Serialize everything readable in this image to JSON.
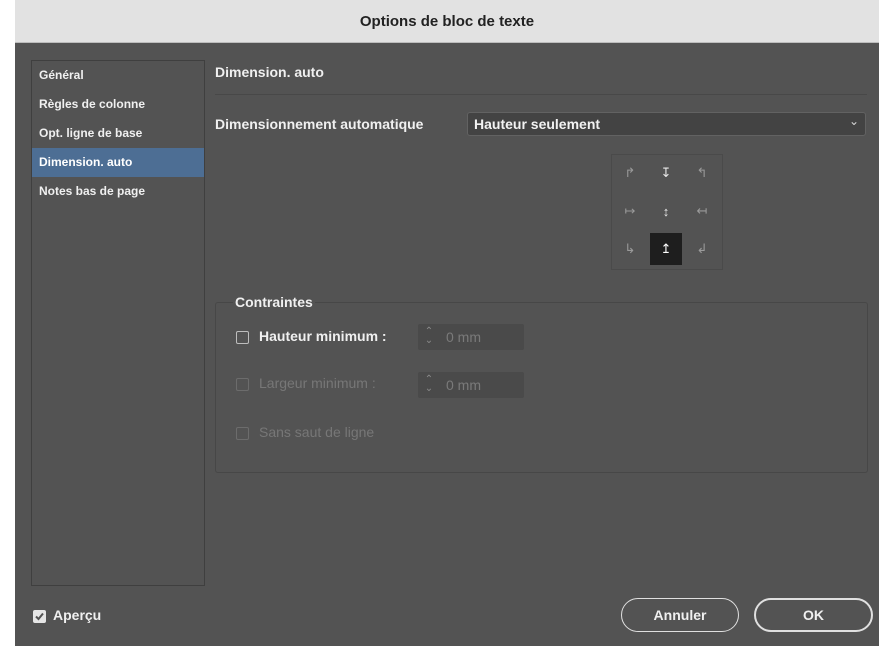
{
  "dialog": {
    "title": "Options de bloc de texte"
  },
  "sidebar": {
    "items": [
      {
        "label": "Général"
      },
      {
        "label": "Règles de colonne"
      },
      {
        "label": "Opt. ligne de base"
      },
      {
        "label": "Dimension. auto"
      },
      {
        "label": "Notes bas de page"
      }
    ],
    "active_index": 3
  },
  "main": {
    "section_title": "Dimension. auto",
    "auto_size_label": "Dimensionnement automatique",
    "auto_size_value": "Hauteur seulement",
    "reference_point": {
      "cells": [
        "↱",
        "↧",
        "↰",
        "↦",
        "↕",
        "↤",
        "↳",
        "↥",
        "↲"
      ],
      "selected_index": 7
    },
    "constraints": {
      "title": "Contraintes",
      "min_height": {
        "label": "Hauteur minimum :",
        "value": "0 mm",
        "checked": false,
        "enabled": true
      },
      "min_width": {
        "label": "Largeur minimum :",
        "value": "0 mm",
        "checked": false,
        "enabled": false
      },
      "no_line_break": {
        "label": "Sans saut de ligne",
        "checked": false,
        "enabled": false
      }
    }
  },
  "footer": {
    "preview_label": "Aperçu",
    "preview_checked": true,
    "cancel_label": "Annuler",
    "ok_label": "OK"
  },
  "colors": {
    "panel": "#535353",
    "active_item": "#4d6e94",
    "titlebar": "#e2e2e2"
  }
}
